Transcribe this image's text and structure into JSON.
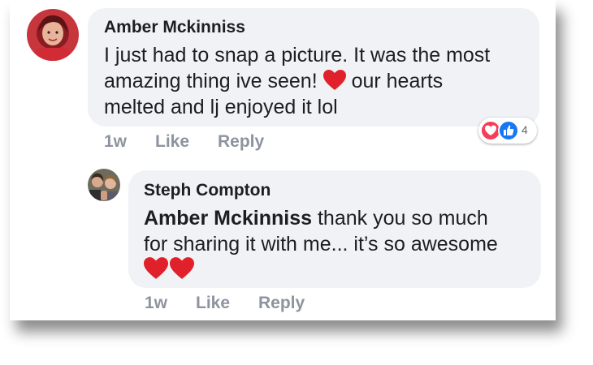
{
  "comments": [
    {
      "author": "Amber Mckinniss",
      "line1": "I just had to snap a picture. It was the most",
      "line2_pre": "amazing thing ive seen!",
      "line2_post": "our hearts",
      "line3": "melted and lj enjoyed it lol",
      "time": "1w",
      "like": "Like",
      "reply": "Reply",
      "reaction_count": "4"
    }
  ],
  "reply": {
    "author": "Steph Compton",
    "mention": "Amber Mckinniss",
    "line1_rest": "thank you so much",
    "line2": "for sharing it with me... it’s so awesome",
    "time": "1w",
    "like": "Like",
    "reply": "Reply"
  },
  "colors": {
    "bubble": "#f0f2f5",
    "meta": "#8d949e",
    "love": "#f33e58",
    "like": "#1877f2",
    "heart_emoji": "#e0202a"
  },
  "icons": [
    "heart-emoji",
    "love-reaction-icon",
    "like-reaction-icon"
  ]
}
